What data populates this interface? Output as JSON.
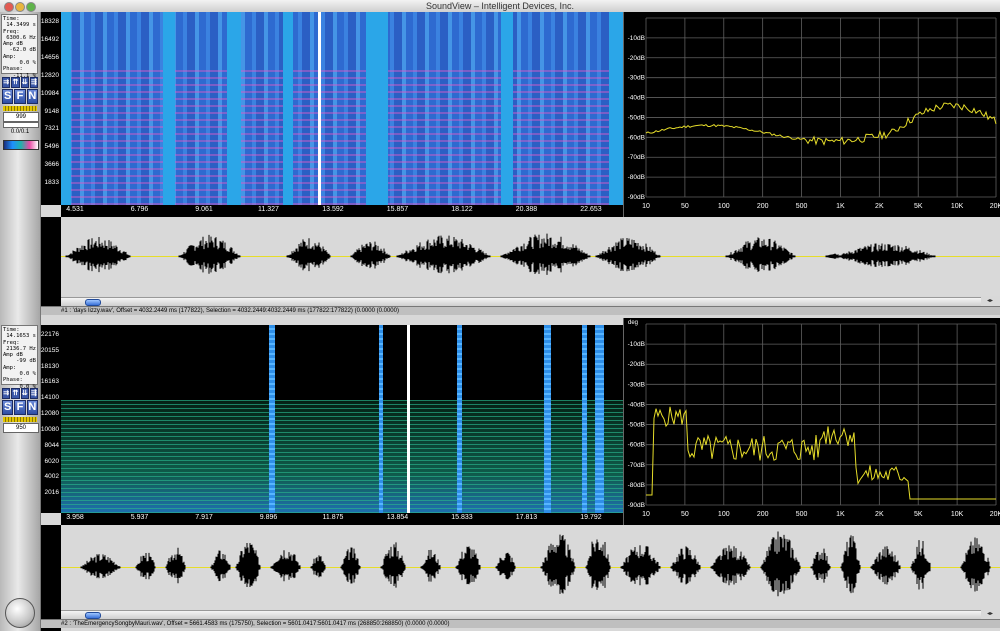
{
  "window": {
    "title": "SoundView – Intelligent Devices, Inc."
  },
  "colors": {
    "accent": "#3a57a8",
    "trace": "#e6dd2a",
    "grid": "#5f5f5f",
    "waveform": "#000000"
  },
  "channel1": {
    "info": {
      "time_label": "Time:",
      "time": "14.3499 s",
      "freq_label": "Freq:",
      "freq": "6300.6 Hz",
      "ampdb_label": "Amp dB",
      "ampdb": "-62.0 dB",
      "amp_label": "Amp:",
      "amp": "0.0 %",
      "phase_label": "Phase:",
      "phase": "-11.1 %"
    },
    "buttons": {
      "b1": "⇉",
      "b2": "⇈",
      "b3": "⇊",
      "b4": "⇶"
    },
    "sfn": {
      "s": "S",
      "f": "F",
      "n": "N"
    },
    "level_value": "999",
    "ratio": "0.0/0.1",
    "y_ticks": [
      "18328",
      "16492",
      "14656",
      "12820",
      "10984",
      "9148",
      "7321",
      "5496",
      "3666",
      "1833"
    ],
    "x_ticks": [
      "4.531",
      "6.796",
      "9.061",
      "11.327",
      "13.592",
      "15.857",
      "18.122",
      "20.388",
      "22.653"
    ],
    "status": "#1 : 'days lizzy.wav', Offset = 4032.2449 ms (177822), Selection = 4032.2449:4032.2449 ms (177822:177822) (0.0000 (0.0000)"
  },
  "channel2": {
    "info": {
      "time_label": "Time:",
      "time": "14.1653 s",
      "freq_label": "Freq:",
      "freq": "2136.7 Hz",
      "ampdb_label": "Amp dB",
      "ampdb": "-99 dB",
      "amp_label": "Amp:",
      "amp": "0.0 %",
      "phase_label": "Phase:",
      "phase": "0.0 %"
    },
    "buttons": {
      "b1": "⇉",
      "b2": "⇈",
      "b3": "⇊",
      "b4": "⇶"
    },
    "sfn": {
      "s": "S",
      "f": "F",
      "n": "N"
    },
    "level_value": "950",
    "y_ticks": [
      "22176",
      "20155",
      "18130",
      "16163",
      "14100",
      "12080",
      "10080",
      "8044",
      "6020",
      "4002",
      "2016"
    ],
    "x_ticks": [
      "3.958",
      "5.937",
      "7.917",
      "9.896",
      "11.875",
      "13.854",
      "15.833",
      "17.813",
      "19.792"
    ],
    "status": "#2 : 'TheEmergencySongbyMauri.wav', Offset = 5661.4583 ms (175750), Selection = 5601.0417:5601.0417 ms (268850:268850) (0.0000 (0.0000)"
  },
  "spectrum": {
    "db_ticks": [
      "-10dB",
      "-20dB",
      "-30dB",
      "-40dB",
      "-50dB",
      "-60dB",
      "-70dB",
      "-80dB",
      "-90dB"
    ],
    "freq_ticks1": [
      "10",
      "50",
      "100",
      "200",
      "500",
      "1K",
      "2K",
      "5K",
      "10K",
      "20K"
    ],
    "freq_ticks2": [
      "10",
      "50",
      "100",
      "200",
      "500",
      "1K",
      "2K",
      "5K",
      "10K",
      "20K"
    ],
    "corner_label": "deg"
  }
}
